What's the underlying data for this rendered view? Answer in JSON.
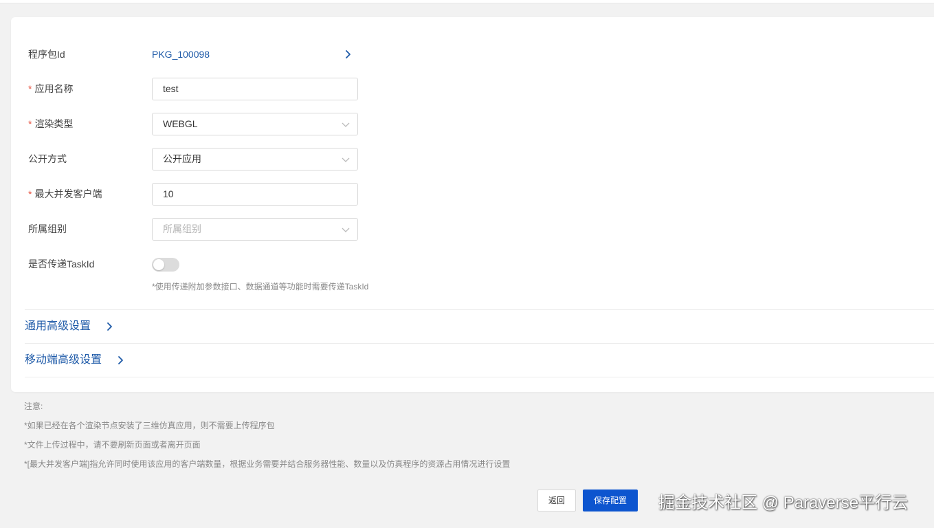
{
  "form": {
    "package_id_label": "程序包Id",
    "package_id_value": "PKG_100098",
    "required_mark": "*",
    "app_name_label": "应用名称",
    "app_name_value": "test",
    "render_type_label": "渲染类型",
    "render_type_value": "WEBGL",
    "visibility_label": "公开方式",
    "visibility_value": "公开应用",
    "max_clients_label": "最大并发客户端",
    "max_clients_value": "10",
    "group_label": "所属组别",
    "group_placeholder": "所属组别",
    "pass_taskid_label": "是否传递TaskId",
    "pass_taskid_enabled": false,
    "pass_taskid_hint": "*使用传递附加参数接口、数据通道等功能时需要传递TaskId"
  },
  "sections": {
    "general_advanced": "通用高级设置",
    "mobile_advanced": "移动端高级设置"
  },
  "notes": {
    "title": "注意:",
    "line1": "*如果已经在各个渲染节点安装了三维仿真应用，则不需要上传程序包",
    "line2": "*文件上传过程中，请不要刷新页面或者离开页面",
    "line3": "*[最大并发客户端]指允许同时使用该应用的客户端数量，根据业务需要并结合服务器性能、数量以及仿真程序的资源占用情况进行设置"
  },
  "buttons": {
    "back": "返回",
    "save": "保存配置"
  },
  "watermark": "掘金技术社区 @ Paraverse平行云",
  "colors": {
    "link": "#1e5aa8",
    "primary": "#0d55cf",
    "required": "#e6513f"
  }
}
